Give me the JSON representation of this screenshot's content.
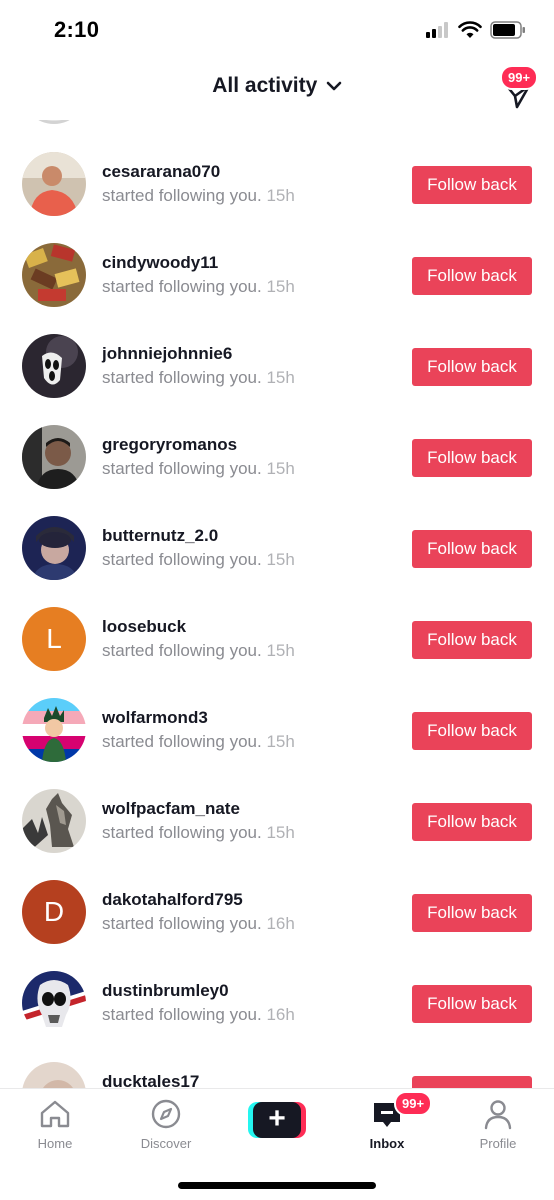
{
  "status_bar": {
    "time": "2:10"
  },
  "header": {
    "title": "All activity",
    "badge": "99+"
  },
  "follow_button_label": "Follow back",
  "subtitle_text": "started following you.",
  "items": [
    {
      "username": "cesararana070",
      "time": "15h"
    },
    {
      "username": "cindywoody11",
      "time": "15h"
    },
    {
      "username": "johnniejohnnie6",
      "time": "15h"
    },
    {
      "username": "gregoryromanos",
      "time": "15h"
    },
    {
      "username": "butternutz_2.0",
      "time": "15h"
    },
    {
      "username": "loosebuck",
      "time": "15h",
      "avatar_letter": "L",
      "avatar_color": "#e67e22"
    },
    {
      "username": "wolfarmond3",
      "time": "15h"
    },
    {
      "username": "wolfpacfam_nate",
      "time": "15h"
    },
    {
      "username": "dakotahalford795",
      "time": "16h",
      "avatar_letter": "D",
      "avatar_color": "#b5401f"
    },
    {
      "username": "dustinbrumley0",
      "time": "16h"
    },
    {
      "username": "ducktales17",
      "time": ""
    }
  ],
  "nav": {
    "home": "Home",
    "discover": "Discover",
    "inbox": "Inbox",
    "inbox_badge": "99+",
    "profile": "Profile"
  },
  "colors": {
    "accent": "#fe2c55",
    "follow_button": "#ea4359",
    "text_primary": "#161823",
    "text_secondary": "#8a8b91"
  }
}
